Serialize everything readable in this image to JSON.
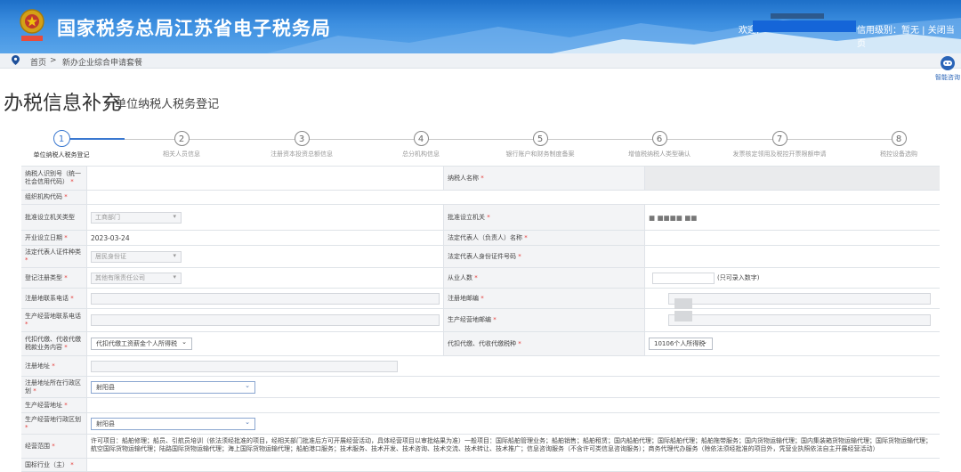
{
  "header": {
    "title": "国家税务总局江苏省电子税务局",
    "welcome": "欢迎,",
    "user_level": "信用级别：暂无 | 关闭当页"
  },
  "breadcrumb": {
    "home": "首页",
    "separator": ">",
    "current": "新办企业综合申请套餐"
  },
  "smart_consult": {
    "label": "智能咨询"
  },
  "page": {
    "title": "办税信息补充",
    "subtitle": "» 单位纳税人税务登记"
  },
  "steps": [
    {
      "num": "1",
      "label": "单位纳税人税务登记",
      "active": true
    },
    {
      "num": "2",
      "label": "相关人员信息",
      "active": false
    },
    {
      "num": "3",
      "label": "注册资本投资总额信息",
      "active": false
    },
    {
      "num": "4",
      "label": "总分机构信息",
      "active": false
    },
    {
      "num": "5",
      "label": "银行账户和财务制度备案",
      "active": false
    },
    {
      "num": "6",
      "label": "增值税纳税人类型确认",
      "active": false
    },
    {
      "num": "7",
      "label": "发票核定领用及税控开票限额申请",
      "active": false
    },
    {
      "num": "8",
      "label": "税控设备选购",
      "active": false
    }
  ],
  "form": {
    "r1": {
      "label1": "纳税人识别号（统一社会信用代码）",
      "label2": "纳税人名称"
    },
    "r2": {
      "label1": "组织机构代码"
    },
    "r3": {
      "label1": "批准设立机关类型",
      "select1": "工商部门",
      "label2": "批准设立机关",
      "value2": "■ ■■■■ ■■"
    },
    "r4": {
      "label1": "开业设立日期",
      "value1": "2023-03-24",
      "label2": "法定代表人（负责人）名称"
    },
    "r5": {
      "label1": "法定代表人证件种类",
      "select1": "居民身份证",
      "label2": "法定代表人身份证件号码"
    },
    "r6": {
      "label1": "登记注册类型",
      "select1": "其他有限责任公司",
      "label2": "从业人数",
      "hint2": "(只可录入数字)"
    },
    "r7": {
      "label1": "注册地联系电话",
      "label2": "注册地邮编"
    },
    "r8": {
      "label1": "生产经营地联系电话",
      "label2": "生产经营地邮编"
    },
    "r9": {
      "label1": "代扣代缴、代收代缴税款业务内容",
      "select1": "代扣代缴工资薪金个人所得税",
      "label2": "代扣代缴、代收代缴税种",
      "select2": "10106个人所得税"
    },
    "r10": {
      "label1": "注册地址"
    },
    "r11": {
      "label1": "注册地址所在行政区划",
      "select1": "射阳县"
    },
    "r12": {
      "label1": "生产经营地址"
    },
    "r13": {
      "label1": "生产经营地行政区划",
      "select1": "射阳县"
    },
    "r14": {
      "label1": "经营范围",
      "text": "许可项目：船舶修理；船员、引航员培训（依法须经批准的项目，经相关部门批准后方可开展经营活动，具体经营项目以审批结果为准）一般项目：国际船舶管理业务；船舶销售；船舶租赁；国内船舶代理；国际船舶代理；船舶拖带服务；国内货物运输代理；国内集装箱货物运输代理；国际货物运输代理；航空国际货物运输代理；陆路国际货物运输代理；海上国际货物运输代理；船舶港口服务；技术服务、技术开发、技术咨询、技术交流、技术转让、技术推广；信息咨询服务（不含许可类信息咨询服务）；商务代理代办服务（除依法须经批准的项目外，凭营业执照依法自主开展经营活动）"
    },
    "r15": {
      "label1": "国标行业（主）"
    }
  }
}
